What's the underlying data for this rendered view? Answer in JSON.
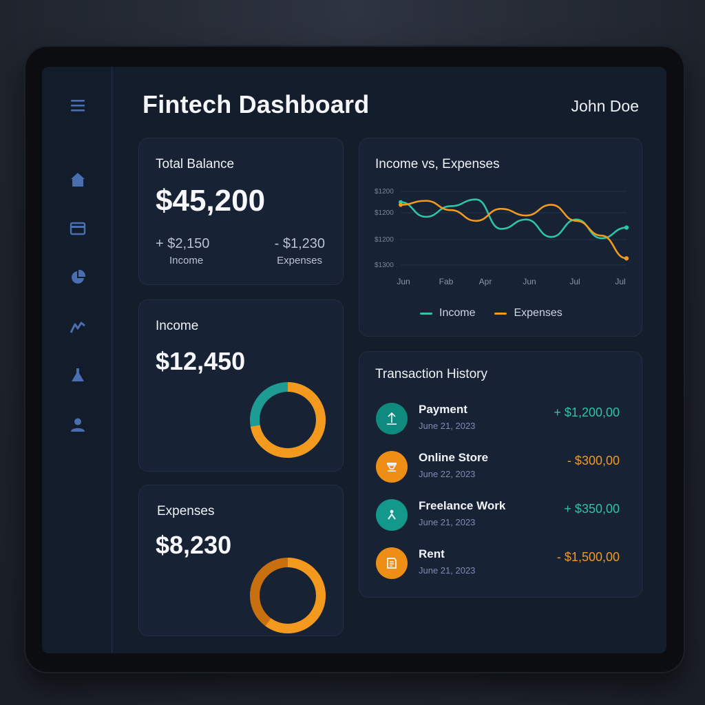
{
  "header": {
    "title": "Fintech Dashboard",
    "user": "John Doe"
  },
  "sidebar": {
    "items": [
      {
        "icon": "menu-icon"
      },
      {
        "icon": "home-icon"
      },
      {
        "icon": "card-icon"
      },
      {
        "icon": "pie-chart-icon"
      },
      {
        "icon": "trend-icon"
      },
      {
        "icon": "flask-icon"
      },
      {
        "icon": "user-icon"
      }
    ]
  },
  "balance": {
    "title": "Total Balance",
    "value": "$45,200",
    "income_delta": "+ $2,150",
    "income_label": "Income",
    "expense_delta": "- $1,230",
    "expense_label": "Expenses"
  },
  "income_card": {
    "title": "Income",
    "value": "$12,450",
    "donut_fraction": 0.72
  },
  "expenses_card": {
    "title": "Expenses",
    "value": "$8,230",
    "donut_fraction": 0.6
  },
  "colors": {
    "income": "#2ec4a6",
    "expense": "#f39a1e",
    "income_dark": "#1e9c93",
    "expense_dark": "#c8700f"
  },
  "chart_data": {
    "type": "line",
    "title": "Income vs, Expenses",
    "x": [
      "Jun",
      "Fab",
      "Apr",
      "Jun",
      "Jul",
      "Jul"
    ],
    "y_tick_labels": [
      "$1200",
      "$1200",
      "$1200",
      "$1300"
    ],
    "series": [
      {
        "name": "Income",
        "color": "#2ec4a6",
        "values": [
          1302,
          1291,
          1299,
          1304,
          1282,
          1289,
          1276,
          1289,
          1275,
          1283
        ]
      },
      {
        "name": "Expenses",
        "color": "#f39a1e",
        "values": [
          1300,
          1303,
          1296,
          1288,
          1297,
          1292,
          1300,
          1288,
          1277,
          1260
        ]
      }
    ],
    "legend": "bottom",
    "grid": true
  },
  "transactions": {
    "title": "Transaction History",
    "items": [
      {
        "name": "Payment",
        "date": "June 21, 2023",
        "amount": "+ $1,200,00",
        "type": "income",
        "icon": "upload-icon"
      },
      {
        "name": "Online Store",
        "date": "June 22, 2023",
        "amount": "- $300,00",
        "type": "expense",
        "icon": "store-icon"
      },
      {
        "name": "Freelance Work",
        "date": "June 21, 2023",
        "amount": "+ $350,00",
        "type": "income",
        "icon": "person-icon"
      },
      {
        "name": "Rent",
        "date": "June 21, 2023",
        "amount": "- $1,500,00",
        "type": "expense",
        "icon": "receipt-icon"
      }
    ]
  }
}
